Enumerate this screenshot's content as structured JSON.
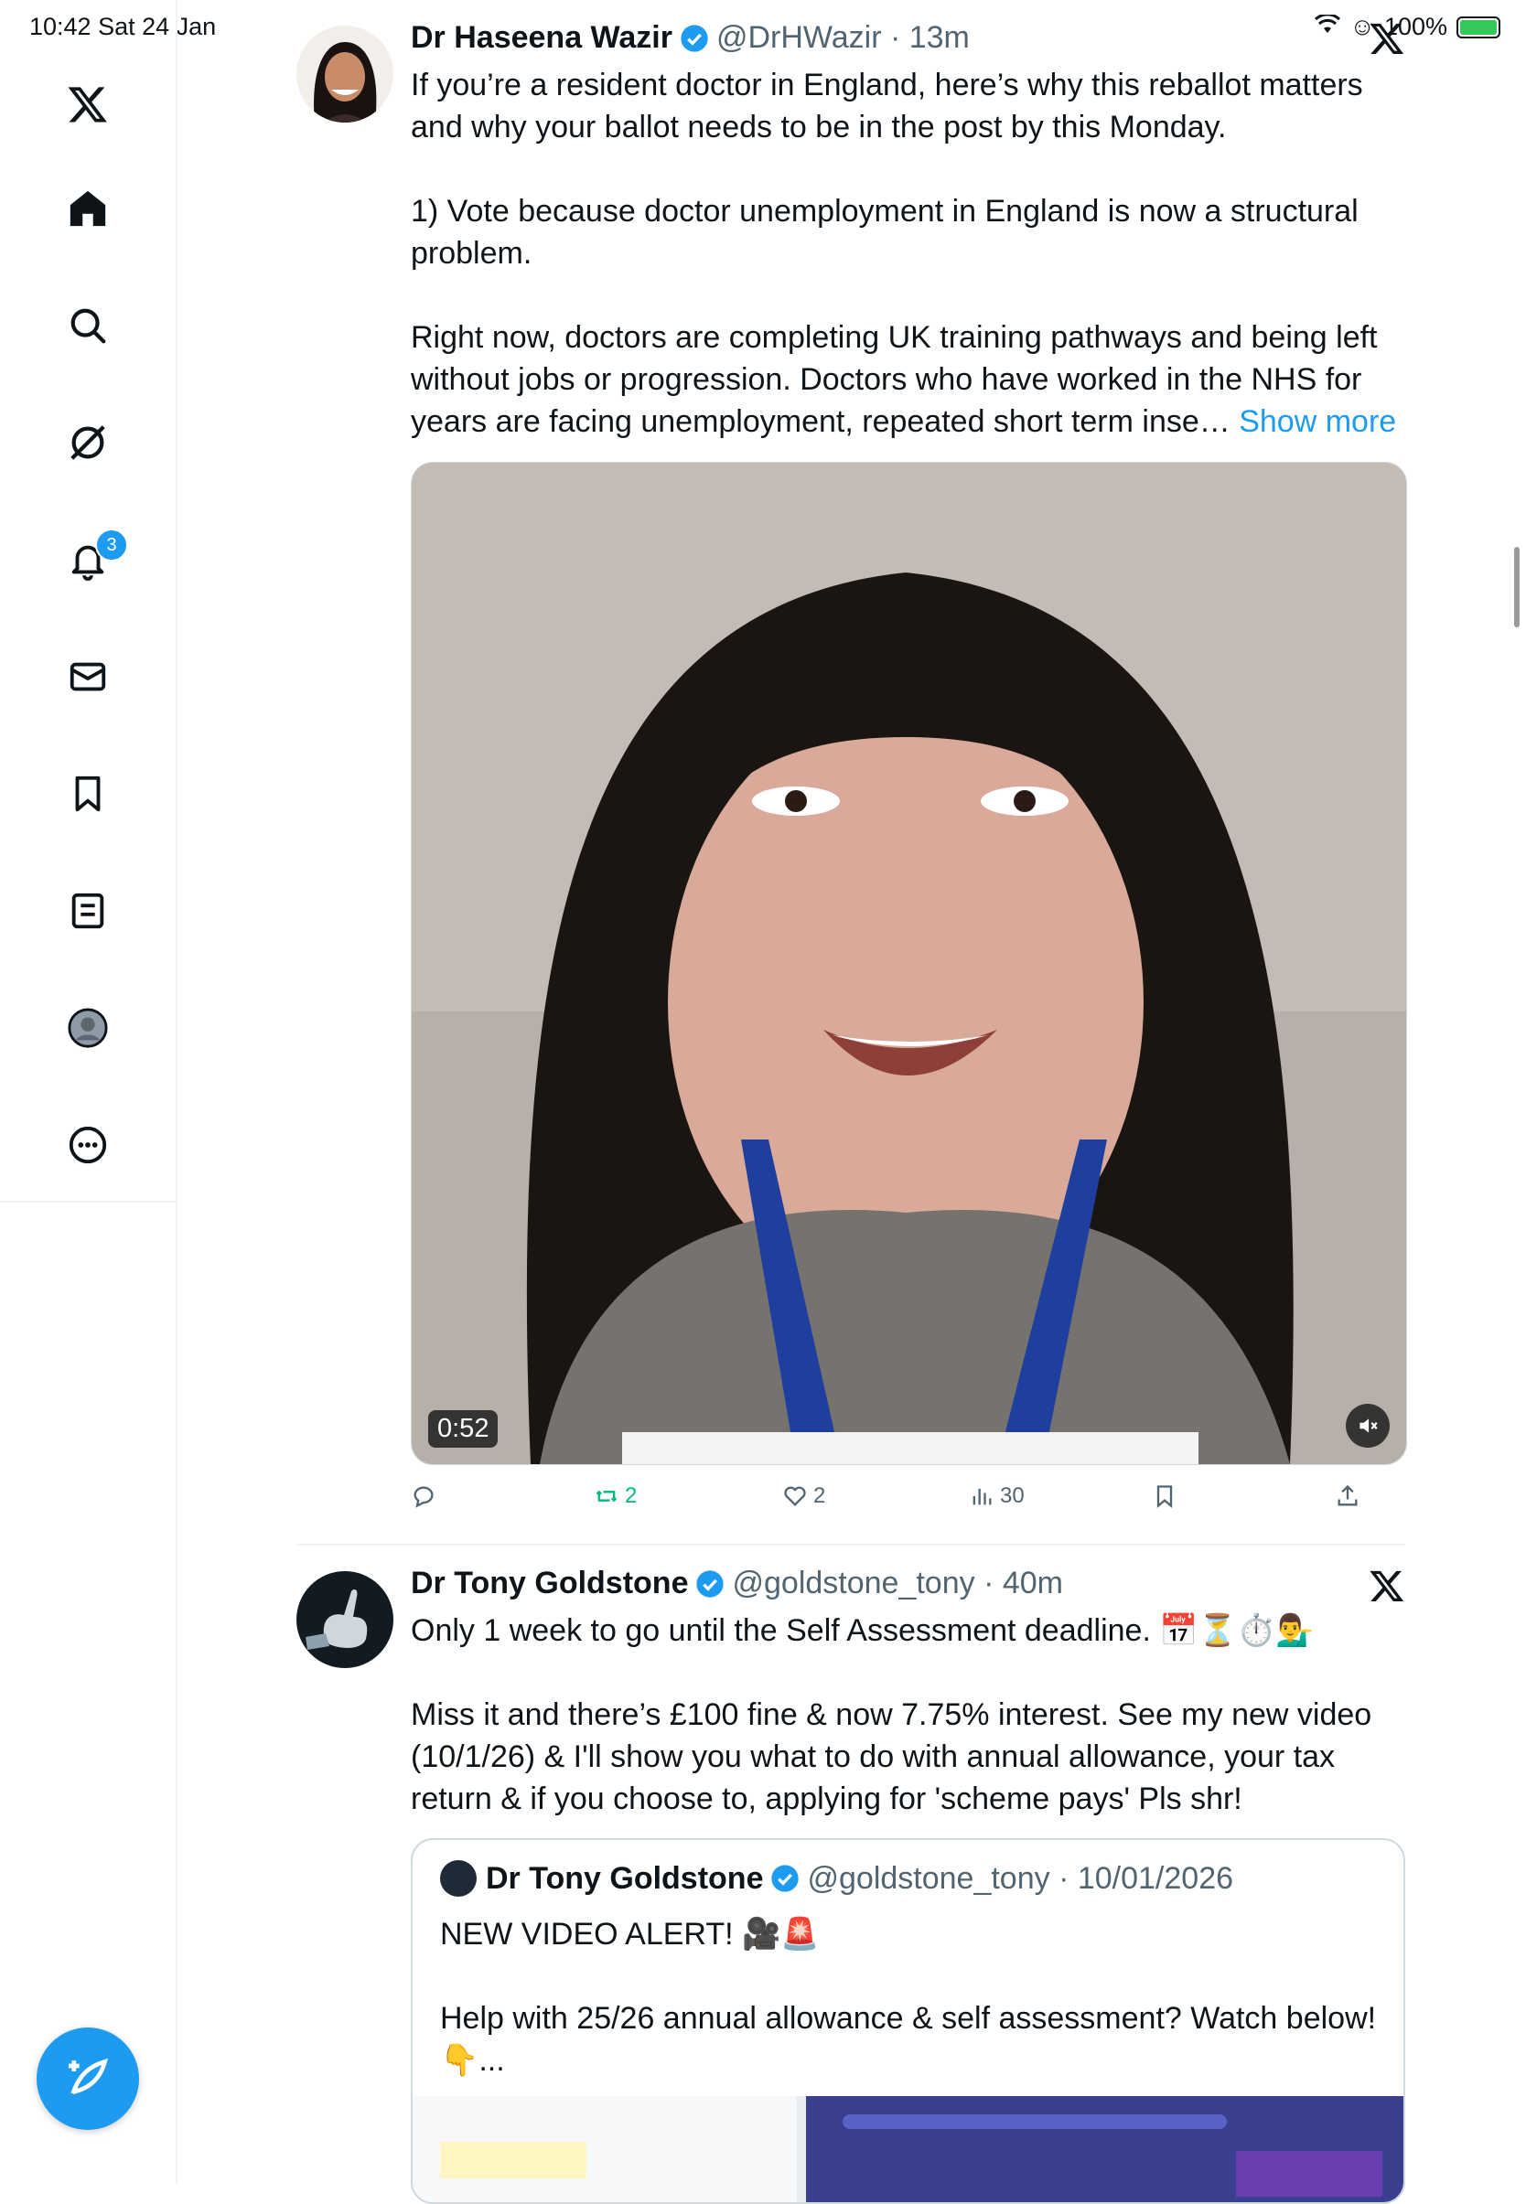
{
  "status_bar": {
    "time": "10:42  Sat 24 Jan",
    "battery": "100%"
  },
  "sidebar": {
    "notifications_badge": "3",
    "items": [
      "x-logo",
      "home",
      "search",
      "grok",
      "notifications",
      "messages",
      "bookmarks",
      "lists",
      "profile",
      "more"
    ]
  },
  "tweets": [
    {
      "name": "Dr Haseena Wazir",
      "handle": "@DrHWazir · 13m",
      "text": "If you’re a resident doctor in England, here’s why this reballot matters and why your ballot needs to be in the post by this Monday.\n\n1) Vote because doctor unemployment in England is now a structural problem.\n\nRight now, doctors are completing UK training pathways and being left without jobs or progression. Doctors who have worked in the NHS for years are facing unemployment, repeated short term inse… ",
      "show_more": "Show more",
      "video_duration": "0:52",
      "actions": {
        "replies": "",
        "reposts": "2",
        "likes": "2",
        "views": "30"
      }
    },
    {
      "name": "Dr Tony Goldstone",
      "handle": "@goldstone_tony · 40m",
      "text": "Only 1 week to go until the Self Assessment deadline. 📅⏳⏱️💁‍♂️\n\nMiss it and there’s £100 fine & now 7.75% interest. See my new video (10/1/26) & I'll show you what to do with annual allowance, your tax return & if you choose to, applying for 'scheme pays' Pls shr!",
      "quote": {
        "name": "Dr Tony Goldstone",
        "handle": "@goldstone_tony · 10/01/2026",
        "text": "NEW VIDEO ALERT! 🎥🚨\n\nHelp with 25/26 annual allowance & self assessment? Watch below!  👇..."
      }
    }
  ],
  "colors": {
    "accent": "#1d9bf0",
    "repost_active": "#00ba7c",
    "secondary_text": "#536471"
  }
}
